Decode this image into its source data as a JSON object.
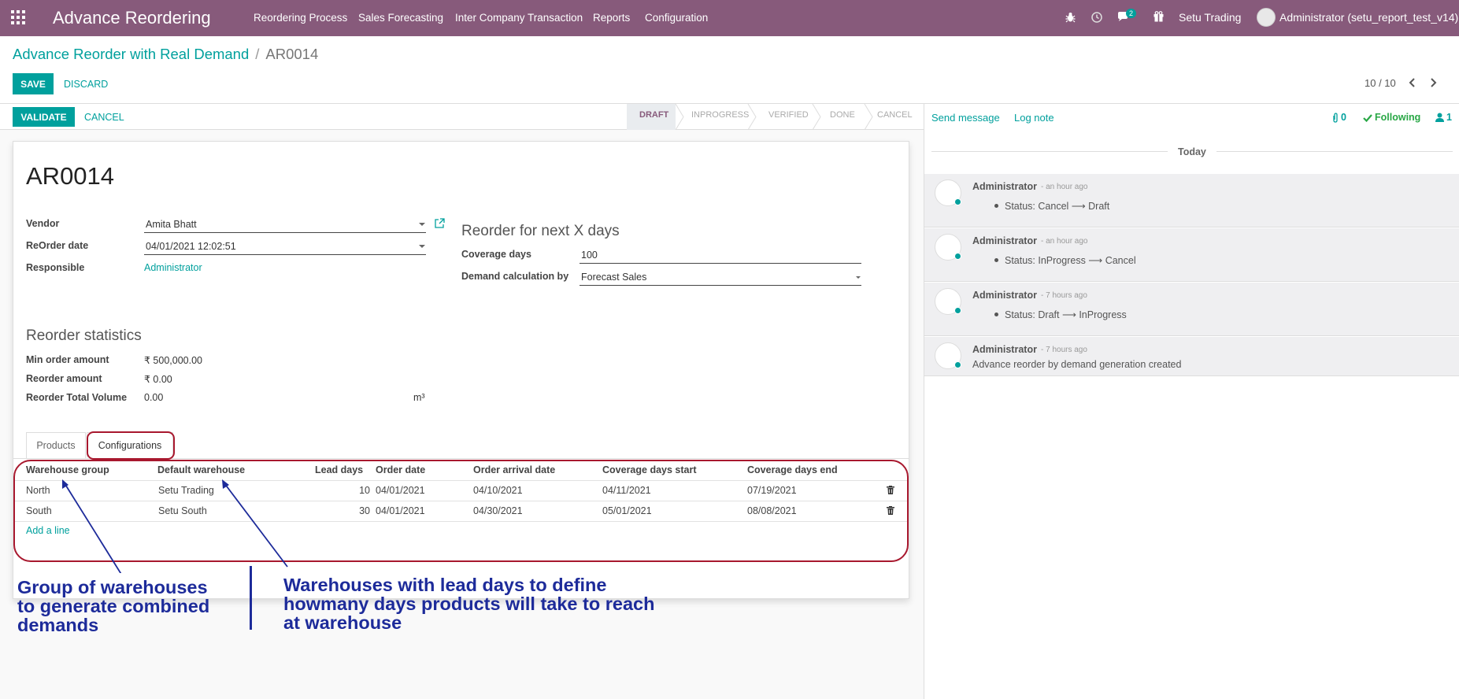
{
  "navbar": {
    "app_name": "Advance Reordering",
    "menus": [
      "Reordering Process",
      "Sales Forecasting",
      "Inter Company Transaction",
      "Reports",
      "Configuration"
    ],
    "chat_count": "2",
    "company": "Setu Trading",
    "user": "Administrator (setu_report_test_v14)",
    "icons": [
      "apps-grid-icon",
      "bug-icon",
      "clock-icon",
      "chat-icon",
      "gift-icon",
      "user-avatar"
    ]
  },
  "breadcrumb": {
    "parent": "Advance Reorder with Real Demand",
    "separator": "/",
    "current": "AR0014"
  },
  "buttons": {
    "save": "SAVE",
    "discard": "DISCARD",
    "validate": "VALIDATE",
    "cancel": "CANCEL"
  },
  "pager": {
    "value": "10 / 10"
  },
  "statusbar": {
    "stages": [
      "DRAFT",
      "INPROGRESS",
      "VERIFIED",
      "DONE",
      "CANCEL"
    ],
    "active": "DRAFT"
  },
  "form": {
    "name": "AR0014",
    "vendor_label": "Vendor",
    "vendor": "Amita Bhatt",
    "reorder_date_label": "ReOrder date",
    "reorder_date": "04/01/2021 12:02:51",
    "responsible_label": "Responsible",
    "responsible": "Administrator",
    "reorder_next_title": "Reorder for next X days",
    "coverage_days_label": "Coverage days",
    "coverage_days": "100",
    "demand_calc_label": "Demand calculation by",
    "demand_calc": "Forecast Sales",
    "stats_title": "Reorder statistics",
    "min_order_label": "Min order amount",
    "min_order": "₹ 500,000.00",
    "reorder_amount_label": "Reorder amount",
    "reorder_amount": "₹ 0.00",
    "total_volume_label": "Reorder Total Volume",
    "total_volume": "0.00",
    "volume_unit": "m³"
  },
  "tabs": [
    "Products",
    "Configurations"
  ],
  "table": {
    "headers": [
      "Warehouse group",
      "Default warehouse",
      "Lead days",
      "Order date",
      "Order arrival date",
      "Coverage days start",
      "Coverage days end"
    ],
    "rows": [
      [
        "North",
        "Setu Trading",
        "10",
        "04/01/2021",
        "04/10/2021",
        "04/11/2021",
        "07/19/2021"
      ],
      [
        "South",
        "Setu South",
        "30",
        "04/01/2021",
        "04/30/2021",
        "05/01/2021",
        "08/08/2021"
      ]
    ],
    "add_line": "Add a line"
  },
  "annotations": {
    "left": [
      "Group of warehouses",
      "to generate combined",
      "demands"
    ],
    "right": [
      "Warehouses with lead days to define",
      "howmany days products will take to reach",
      "at warehouse"
    ]
  },
  "chatter": {
    "send_message": "Send message",
    "log_note": "Log note",
    "attachments": "0",
    "following": "Following",
    "followers": "1",
    "today": "Today",
    "messages": [
      {
        "author": "Administrator",
        "time": "- an hour ago",
        "text": "Status: Cancel ⟶ Draft",
        "bullet": true
      },
      {
        "author": "Administrator",
        "time": "- an hour ago",
        "text": "Status: InProgress ⟶ Cancel",
        "bullet": true
      },
      {
        "author": "Administrator",
        "time": "- 7 hours ago",
        "text": "Status: Draft ⟶ InProgress",
        "bullet": true
      },
      {
        "author": "Administrator",
        "time": "- 7 hours ago",
        "text": "Advance reorder by demand generation created",
        "bullet": false
      }
    ]
  }
}
